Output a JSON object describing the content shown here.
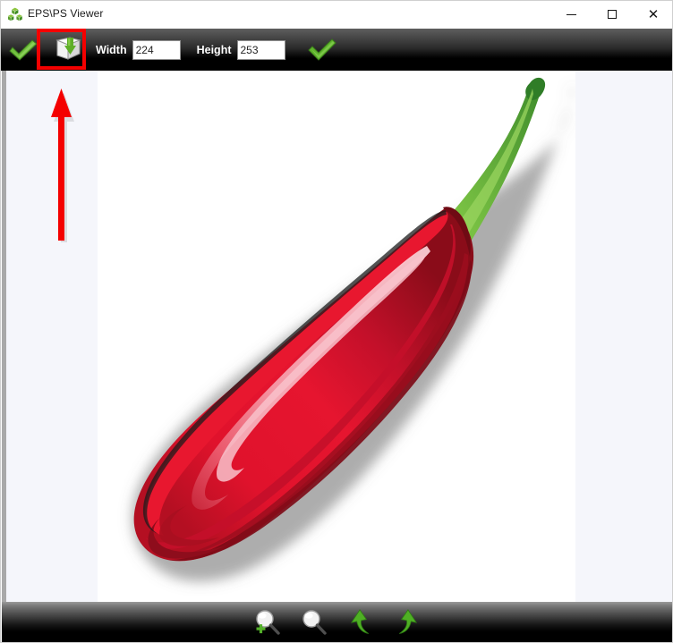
{
  "window": {
    "title": "EPS\\PS Viewer",
    "app_icon": "green-cubes-icon",
    "controls": {
      "minimize": "—",
      "maximize": "□",
      "close": "✕"
    }
  },
  "toolbar_top": {
    "buttons": [
      {
        "name": "apply-check-button",
        "icon": "green-check-arrow-icon",
        "label": ""
      },
      {
        "name": "save-image-button",
        "icon": "save-download-icon",
        "label": "",
        "highlighted": true
      }
    ],
    "fields": [
      {
        "name": "width-field",
        "label": "Width",
        "value": "224",
        "placeholder": "Width"
      },
      {
        "name": "height-field",
        "label": "Height",
        "value": "253",
        "placeholder": "Height"
      }
    ],
    "confirm": {
      "name": "confirm-resize-button",
      "icon": "green-checkmark-icon",
      "label": ""
    }
  },
  "toolbar_bottom": {
    "buttons": [
      {
        "name": "zoom-in-button",
        "icon": "magnifier-plus-icon",
        "label": ""
      },
      {
        "name": "zoom-out-button",
        "icon": "magnifier-icon",
        "label": ""
      },
      {
        "name": "rotate-left-button",
        "icon": "rotate-left-arrow-icon",
        "label": ""
      },
      {
        "name": "rotate-right-button",
        "icon": "rotate-right-arrow-icon",
        "label": ""
      }
    ]
  },
  "annotations": {
    "highlight_box": {
      "name": "save-button-highlight",
      "color": "#f40000"
    },
    "arrow": {
      "name": "pointer-arrow-up",
      "color": "#f40000",
      "direction": "up"
    }
  },
  "canvas": {
    "name": "image-preview",
    "background": "#ffffff",
    "artwork": "red-chili-pepper-sticker",
    "colors": {
      "pepper_bright": "#e3122e",
      "pepper_mid": "#c8102e",
      "pepper_dark": "#8e0d1c",
      "pepper_highlight": "#ef7d8e",
      "stem_light": "#7ac143",
      "stem_dark": "#3f9c35",
      "sticker_outline": "#ffffff"
    }
  },
  "viewport": {
    "background": "#f5f6fb",
    "left_rail": "#a9a9a9"
  }
}
